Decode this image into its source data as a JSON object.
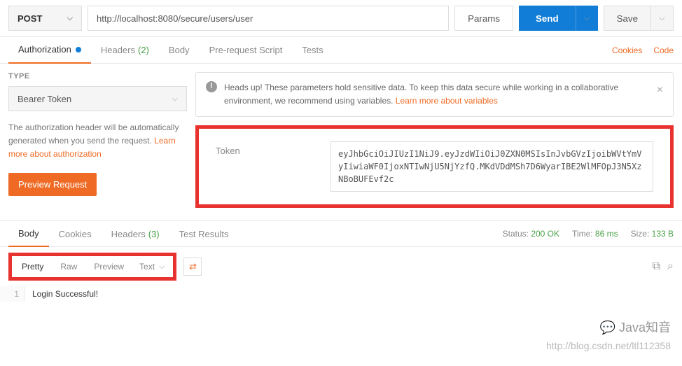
{
  "request": {
    "method": "POST",
    "url": "http://localhost:8080/secure/users/user",
    "params_btn": "Params",
    "send_btn": "Send",
    "save_btn": "Save"
  },
  "tabs": {
    "auth": "Authorization",
    "headers": "Headers",
    "headers_count": "(2)",
    "body": "Body",
    "prereq": "Pre-request Script",
    "tests": "Tests",
    "cookies_link": "Cookies",
    "code_link": "Code"
  },
  "auth": {
    "type_label": "TYPE",
    "type_value": "Bearer Token",
    "desc_1": "The authorization header will be automatically generated when you send the request. ",
    "desc_link": "Learn more about authorization",
    "preview_btn": "Preview Request",
    "alert_text": "Heads up! These parameters hold sensitive data. To keep this data secure while working in a collaborative environment, we recommend using variables. ",
    "alert_link": "Learn more about variables",
    "token_label": "Token",
    "token_value": "eyJhbGciOiJIUzI1NiJ9.eyJzdWIiOiJ0ZXN0MSIsInJvbGVzIjoibWVtYmVyIiwiaWF0IjoxNTIwNjU5NjYzfQ.MKdVDdMSh7D6WyarIBE2WlMFOpJ3N5XzNBoBUFEvf2c"
  },
  "response": {
    "tabs": {
      "body": "Body",
      "cookies": "Cookies",
      "headers": "Headers",
      "headers_count": "(3)",
      "tests": "Test Results"
    },
    "status_lbl": "Status:",
    "status_val": "200 OK",
    "time_lbl": "Time:",
    "time_val": "86 ms",
    "size_lbl": "Size:",
    "size_val": "133 B",
    "fmt": {
      "pretty": "Pretty",
      "raw": "Raw",
      "preview": "Preview",
      "content_type": "Text"
    },
    "line_no": "1",
    "body_text": "Login Successful!"
  },
  "watermark": {
    "title": "Java知音",
    "url": "http://blog.csdn.net/ltl112358"
  }
}
